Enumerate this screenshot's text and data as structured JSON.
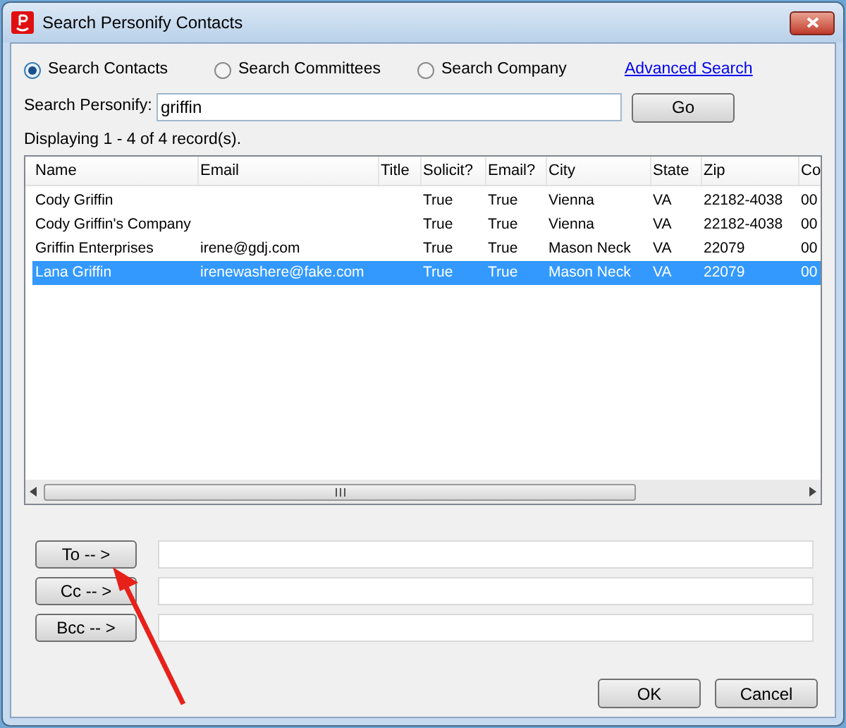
{
  "window": {
    "title": "Search Personify Contacts"
  },
  "search_types": [
    {
      "label": "Search Contacts",
      "selected": true
    },
    {
      "label": "Search Committees",
      "selected": false
    },
    {
      "label": "Search Company",
      "selected": false
    }
  ],
  "advanced_link": "Advanced Search",
  "search": {
    "label": "Search Personify:",
    "value": "griffin",
    "button": "Go"
  },
  "result_count": "Displaying 1 - 4 of 4 record(s).",
  "table": {
    "columns": [
      "Name",
      "Email",
      "Title",
      "Solicit?",
      "Email?",
      "City",
      "State",
      "Zip",
      "Co"
    ],
    "rows": [
      {
        "cells": [
          "Cody Griffin",
          null,
          null,
          "True",
          "True",
          "Vienna",
          "VA",
          "22182-4038",
          "00"
        ],
        "selected": false
      },
      {
        "cells": [
          "Cody Griffin's Company",
          null,
          null,
          "True",
          "True",
          "Vienna",
          "VA",
          "22182-4038",
          "00"
        ],
        "selected": false
      },
      {
        "cells": [
          "Griffin Enterprises",
          "irene@gdj.com",
          null,
          "True",
          "True",
          "Mason Neck",
          "VA",
          "22079",
          "00"
        ],
        "selected": false
      },
      {
        "cells": [
          "Lana Griffin",
          "irenewashere@fake.com",
          null,
          "True",
          "True",
          "Mason Neck",
          "VA",
          "22079",
          "00"
        ],
        "selected": true
      }
    ]
  },
  "recipients": [
    {
      "button": "To -- >"
    },
    {
      "button": "Cc -- >"
    },
    {
      "button": "Bcc -- >"
    }
  ],
  "buttons": [
    "OK",
    "Cancel"
  ]
}
